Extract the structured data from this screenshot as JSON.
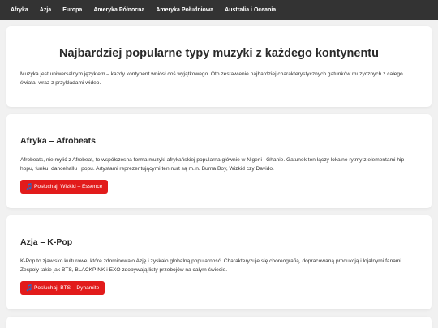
{
  "nav": {
    "items": [
      {
        "label": "Afryka"
      },
      {
        "label": "Azja"
      },
      {
        "label": "Europa"
      },
      {
        "label": "Ameryka Północna"
      },
      {
        "label": "Ameryka Południowa"
      },
      {
        "label": "Australia i Oceania"
      }
    ]
  },
  "intro": {
    "title": "Najbardziej popularne typy muzyki z każdego kontynentu",
    "text": "Muzyka jest uniwersalnym językiem – każdy kontynent wniósł coś wyjątkowego. Oto zestawienie najbardziej charakterystycznych gatunków muzycznych z całego świata, wraz z przykładami wideo."
  },
  "sections": [
    {
      "title": "Afryka – Afrobeats",
      "text": "Afrobeats, nie mylić z Afrobeat, to współczesna forma muzyki afrykańskiej popularna głównie w Nigerii i Ghanie. Gatunek ten łączy lokalne rytmy z elementami hip-hopu, funku, dancehallu i popu. Artystami reprezentującymi ten nurt są m.in. Burna Boy, Wizkid czy Davido.",
      "button": "Posłuchaj: Wizkid – Essence"
    },
    {
      "title": "Azja – K-Pop",
      "text": "K-Pop to zjawisko kulturowe, które zdominowało Azję i zyskało globalną popularność. Charakteryzuje się choreografią, dopracowaną produkcją i lojalnymi fanami. Zespoły takie jak BTS, BLACKPINK i EXO zdobywają listy przebojów na całym świecie.",
      "button": "Posłuchaj: BTS – Dynamite"
    }
  ],
  "colors": {
    "nav_bg": "#333333",
    "button_bg": "#e21b1b",
    "page_bg": "#f1f1f1"
  },
  "icons": {
    "button_icon": "music-note-icon"
  }
}
